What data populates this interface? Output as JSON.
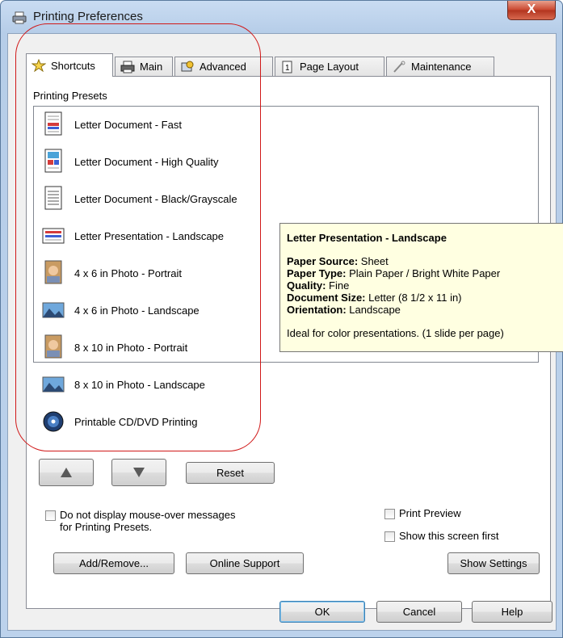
{
  "window": {
    "title": "Printing Preferences",
    "close_glyph": "X"
  },
  "tabs": [
    {
      "label": "Shortcuts",
      "icon": "star-icon"
    },
    {
      "label": "Main",
      "icon": "printer-icon"
    },
    {
      "label": "Advanced",
      "icon": "advanced-icon"
    },
    {
      "label": "Page Layout",
      "icon": "page-layout-icon"
    },
    {
      "label": "Maintenance",
      "icon": "wrench-icon"
    }
  ],
  "presets": {
    "label": "Printing Presets",
    "items": [
      {
        "label": "Letter Document - Fast",
        "icon": "document-fast-icon"
      },
      {
        "label": "Letter Document - High Quality",
        "icon": "document-high-quality-icon"
      },
      {
        "label": "Letter Document - Black/Grayscale",
        "icon": "document-grayscale-icon"
      },
      {
        "label": "Letter Presentation - Landscape",
        "icon": "presentation-landscape-icon"
      },
      {
        "label": "4 x 6 in Photo - Portrait",
        "icon": "photo-portrait-icon"
      },
      {
        "label": "4 x 6 in Photo - Landscape",
        "icon": "photo-landscape-icon"
      },
      {
        "label": "8 x 10 in Photo - Portrait",
        "icon": "photo-portrait-icon"
      },
      {
        "label": "8 x 10 in Photo - Landscape",
        "icon": "photo-landscape-icon"
      },
      {
        "label": "Printable CD/DVD Printing",
        "icon": "cd-dvd-icon"
      }
    ]
  },
  "tooltip": {
    "title": "Letter Presentation - Landscape",
    "rows": [
      {
        "key": "Paper Source:",
        "value": "Sheet"
      },
      {
        "key": "Paper Type:",
        "value": "Plain Paper / Bright White Paper"
      },
      {
        "key": "Quality:",
        "value": "Fine"
      },
      {
        "key": "Document Size:",
        "value": "Letter (8 1/2 x 11 in)"
      },
      {
        "key": "Orientation:",
        "value": "Landscape"
      }
    ],
    "description": "Ideal for color presentations. (1 slide per page)"
  },
  "buttons": {
    "reset": "Reset",
    "add_remove": "Add/Remove...",
    "online_support": "Online Support",
    "show_settings": "Show Settings",
    "ok": "OK",
    "cancel": "Cancel",
    "help": "Help"
  },
  "checkboxes": {
    "no_mouseover": {
      "label_line1": "Do not display mouse-over messages",
      "label_line2": "for Printing Presets.",
      "checked": false
    },
    "print_preview": {
      "label": "Print Preview",
      "checked": false
    },
    "show_first": {
      "label": "Show this screen first",
      "checked": false
    }
  },
  "colors": {
    "highlight_outline": "#d01818",
    "tooltip_bg": "#ffffe1"
  }
}
